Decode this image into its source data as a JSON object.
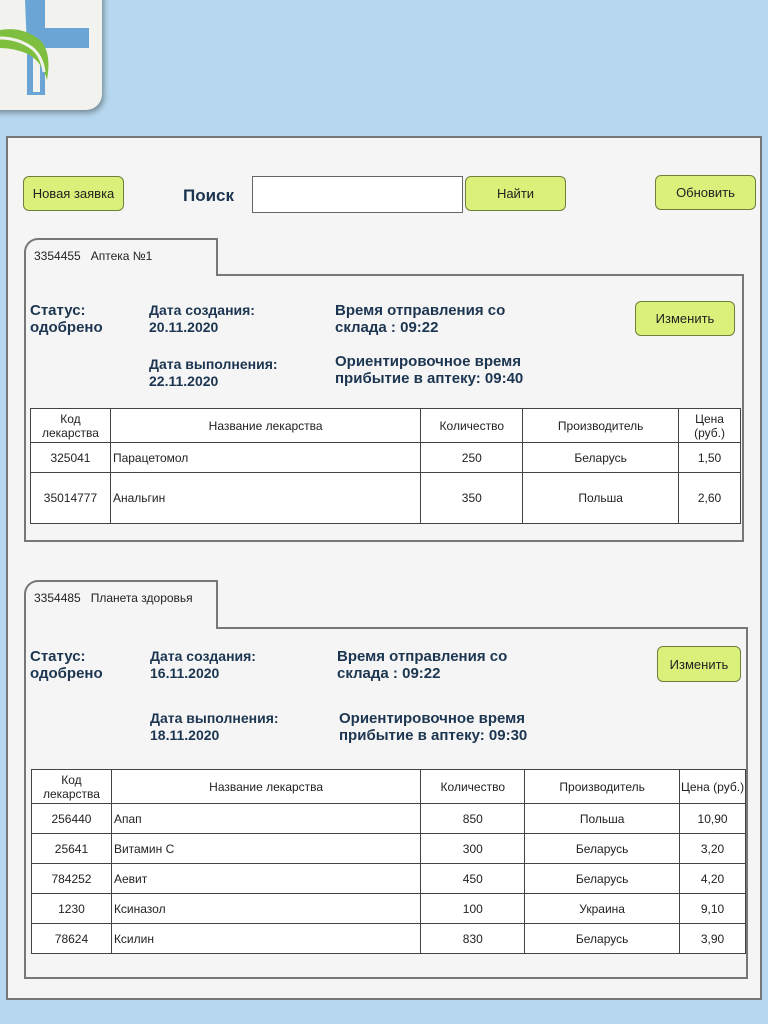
{
  "toolbar": {
    "new_request_label": "Новая заявка",
    "search_label": "Поиск",
    "search_value": "",
    "find_label": "Найти",
    "refresh_label": "Обновить"
  },
  "columns": {
    "code": "Код лекарства",
    "name": "Название лекарства",
    "qty": "Количество",
    "maker": "Производитель",
    "price": "Цена (руб.)"
  },
  "orders": [
    {
      "id": "3354455",
      "pharmacy": "Аптека №1",
      "status": "Статус: одобрено",
      "created": "Дата создания: 20.11.2020",
      "completed": "Дата выполнения: 22.11.2020",
      "depart": "Время отправления со склада : 09:22",
      "arrive": "Ориентировочное время прибытие в аптеку: 09:40",
      "edit_label": "Изменить",
      "rows": [
        {
          "code": "325041",
          "name": "Парацетомол",
          "qty": "250",
          "maker": "Беларусь",
          "price": "1,50"
        },
        {
          "code": "35014777",
          "name": "Анальгин",
          "qty": "350",
          "maker": "Польша",
          "price": "2,60"
        }
      ]
    },
    {
      "id": "3354485",
      "pharmacy": "Планета здоровья",
      "status": "Статус: одобрено",
      "created": "Дата создания: 16.11.2020",
      "completed": "Дата выполнения: 18.11.2020",
      "depart": "Время отправления со склада : 09:22",
      "arrive": "Ориентировочное время прибытие в аптеку: 09:30",
      "edit_label": "Изменить",
      "rows": [
        {
          "code": "256440",
          "name": "Апап",
          "qty": "850",
          "maker": "Польша",
          "price": "10,90"
        },
        {
          "code": "25641",
          "name": "Витамин С",
          "qty": "300",
          "maker": "Беларусь",
          "price": "3,20"
        },
        {
          "code": "784252",
          "name": "Аевит",
          "qty": "450",
          "maker": "Беларусь",
          "price": "4,20"
        },
        {
          "code": "1230",
          "name": "Ксиназол",
          "qty": "100",
          "maker": "Украина",
          "price": "9,10"
        },
        {
          "code": "78624",
          "name": "Ксилин",
          "qty": "830",
          "maker": "Беларусь",
          "price": "3,90"
        }
      ]
    }
  ],
  "colors": {
    "accent": "#d9f07a",
    "background": "#b6d7ef",
    "heading": "#1c3550"
  },
  "logo_icon": "pharmacy-cross-leaf-icon"
}
